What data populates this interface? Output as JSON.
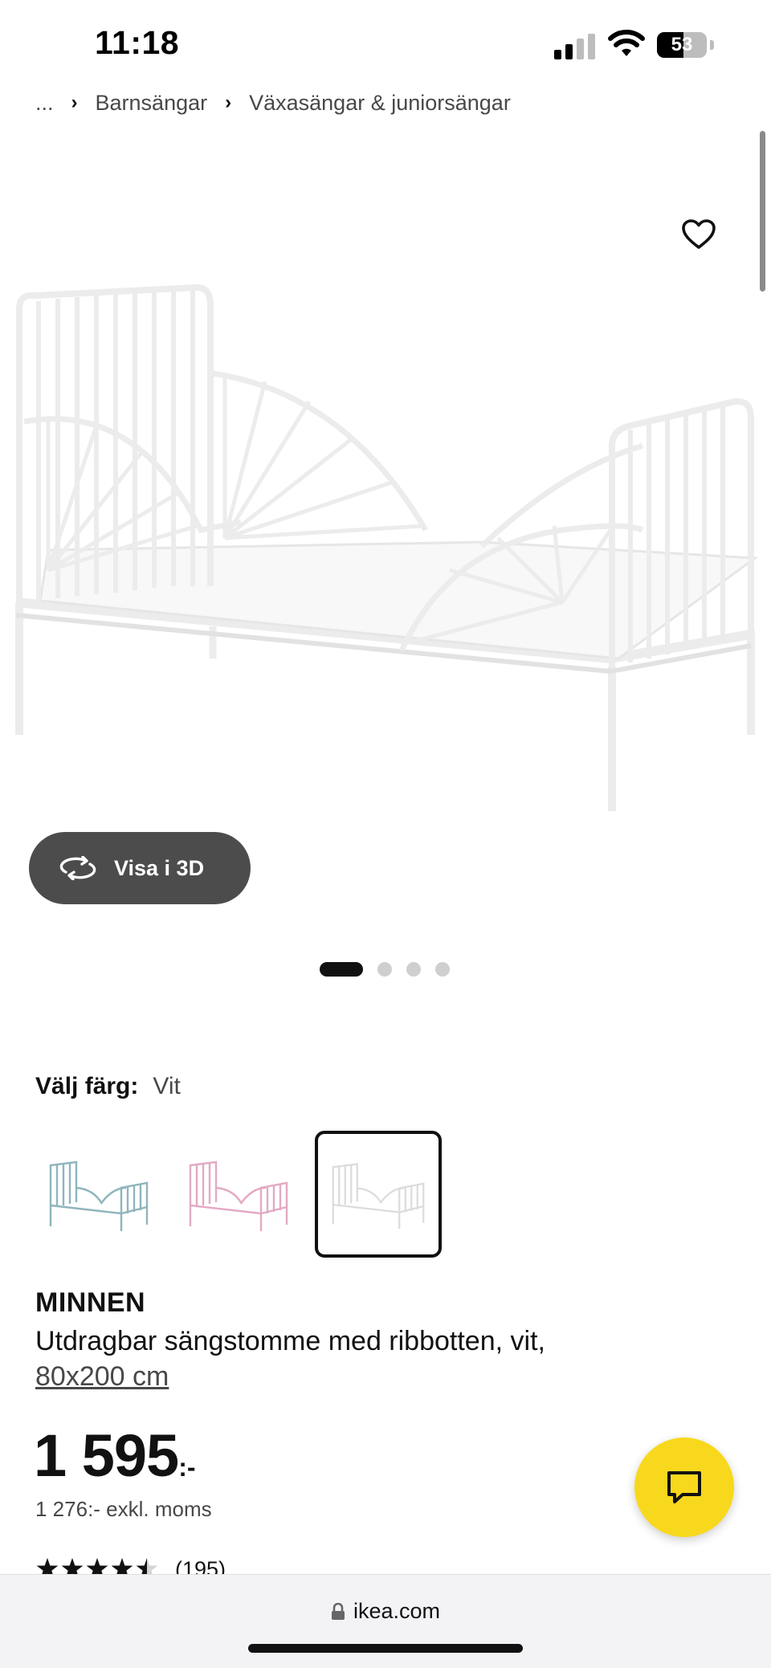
{
  "status_bar": {
    "time": "11:18",
    "battery_level": "53",
    "icons": [
      "cellular-signal-icon",
      "wifi-icon",
      "battery-icon"
    ]
  },
  "breadcrumb": {
    "items": [
      "...",
      "Barnsängar",
      "Växasängar & juniorsängar"
    ]
  },
  "gallery": {
    "view_3d_label": "Visa i 3D",
    "image_count": 4,
    "active_index": 0
  },
  "color_picker": {
    "label": "Välj färg:",
    "selected_value": "Vit",
    "options": [
      "turquoise",
      "pink",
      "white"
    ],
    "selected_index": 2
  },
  "product": {
    "name": "MINNEN",
    "description": "Utdragbar sängstomme med ribbotten, vit,",
    "size": "80x200 cm",
    "price": "1 595",
    "price_suffix": ":-",
    "price_excl_vat": "1 276:- exkl. moms",
    "rating": 4.5,
    "rating_max": 5,
    "review_count": "(195)"
  },
  "browser": {
    "url": "ikea.com"
  },
  "colors": {
    "chat_button": "#f8d81c",
    "view_3d_button": "#4c4c4c"
  }
}
